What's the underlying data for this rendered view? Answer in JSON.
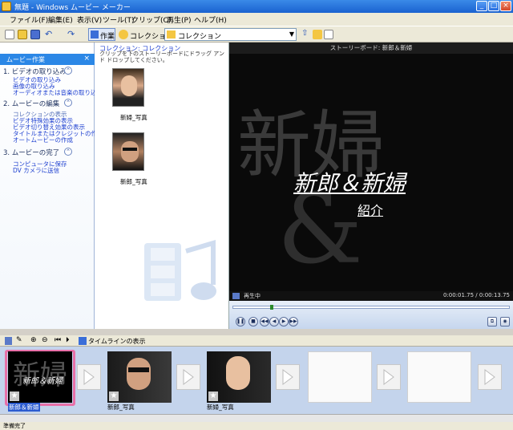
{
  "window": {
    "title": "無題 - Windows ムービー メーカー"
  },
  "menu": [
    "ファイル(F)",
    "編集(E)",
    "表示(V)",
    "ツール(T)",
    "クリップ(C)",
    "再生(P)",
    "ヘルプ(H)"
  ],
  "toolbar": {
    "tasks_label": "作業",
    "collections_label": "コレクション",
    "collection_select": "コレクション"
  },
  "taskpane": {
    "title": "ムービー作業",
    "close": "×",
    "sections": [
      {
        "title": "1. ビデオの取り込み",
        "links": [
          "ビデオの取り込み",
          "画像の取り込み",
          "オーディオまたは音楽の取り込み"
        ]
      },
      {
        "title": "2. ムービーの編集",
        "links": [
          "コレクションの表示",
          "ビデオ特殊効果の表示",
          "ビデオ切り替え効果の表示",
          "タイトルまたはクレジットの作成",
          "オートムービーの作成"
        ]
      },
      {
        "title": "3. ムービーの完了",
        "links": [
          "コンピュータに保存",
          "DV カメラに送信"
        ]
      }
    ]
  },
  "collection": {
    "heading": "コレクション: コレクション",
    "hint": "クリップを下のストーリーボードにドラッグ アンド ドロップしてください。",
    "items": [
      {
        "label": "新婦_写真"
      },
      {
        "label": "新郎_写真"
      }
    ]
  },
  "preview": {
    "title": "ストーリーボード: 新郎＆新婦",
    "caption_line1": "新郎＆新婦",
    "caption_line2": "紹介",
    "bg_text": "新婦",
    "status": "再生中",
    "time": "0:00:01.75 / 0:00:13.75"
  },
  "timeline": {
    "toggle_label": "タイムラインの表示"
  },
  "storyboard": {
    "clips": [
      {
        "label": "新郎＆新婦"
      },
      {
        "label": "新郎_写真"
      },
      {
        "label": "新婦_写真"
      }
    ]
  },
  "status": "準備完了"
}
